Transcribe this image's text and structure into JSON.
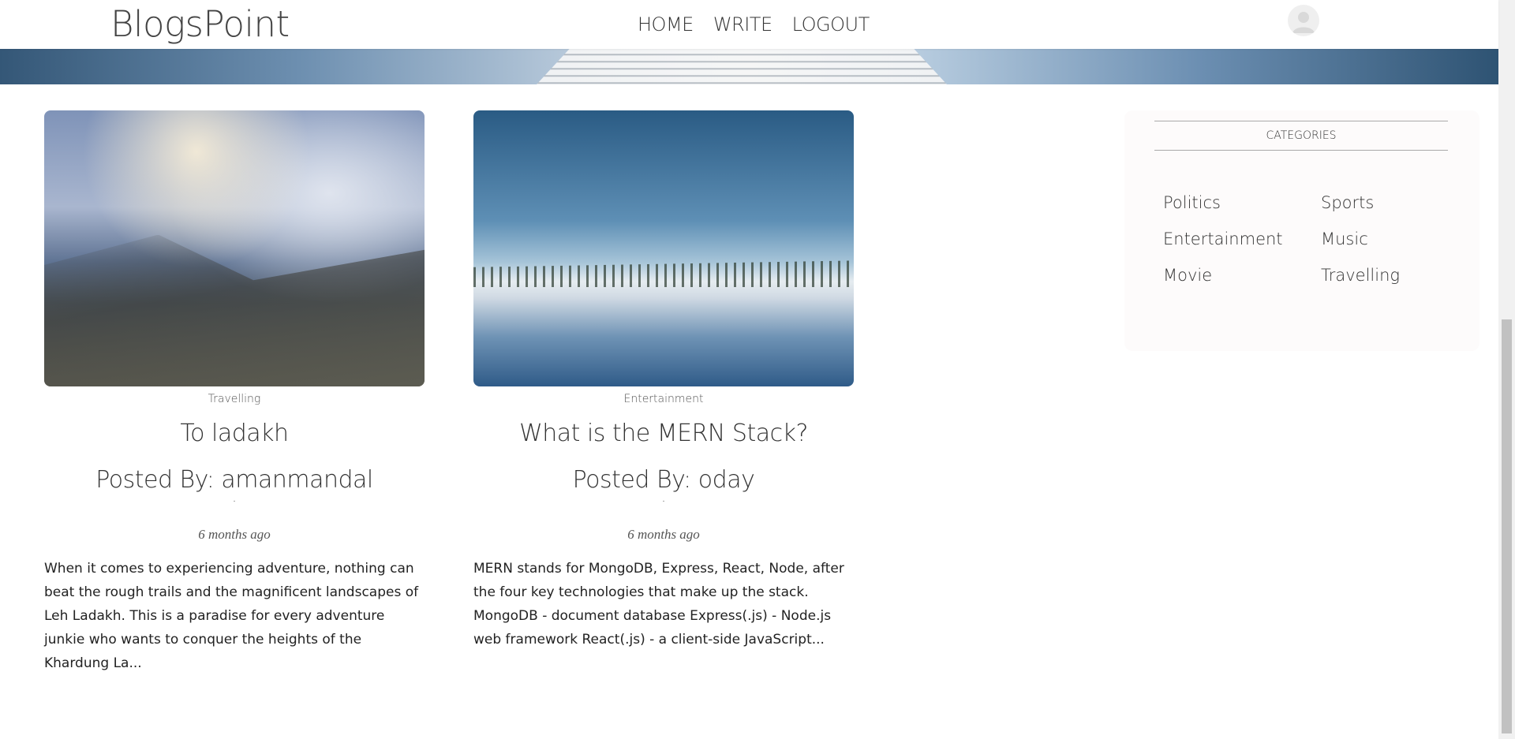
{
  "header": {
    "brand": "BlogsPoint",
    "nav": [
      "HOME",
      "WRITE",
      "LOGOUT"
    ]
  },
  "posts": [
    {
      "category": "Travelling",
      "title": "To ladakh",
      "author": "Posted By: amanmandal",
      "date": "6 months ago",
      "excerpt": "When it comes to experiencing adventure, nothing can beat the rough trails and the magnificent landscapes of Leh Ladakh. This is a paradise for every adventure junkie who wants to conquer the heights of the Khardung La..."
    },
    {
      "category": "Entertainment",
      "title": "What is the MERN Stack?",
      "author": "Posted By: oday",
      "date": "6 months ago",
      "excerpt": "MERN stands for MongoDB, Express, React, Node, after the four key technologies that make up the stack. MongoDB - document database Express(.js) - Node.js web framework React(.js) - a client-side JavaScript..."
    }
  ],
  "sidebar": {
    "title": "CATEGORIES",
    "categories": [
      "Politics",
      "Sports",
      "Entertainment",
      "Music",
      "Movie",
      "Travelling"
    ]
  },
  "icons": {
    "avatar": "user-avatar-icon"
  }
}
